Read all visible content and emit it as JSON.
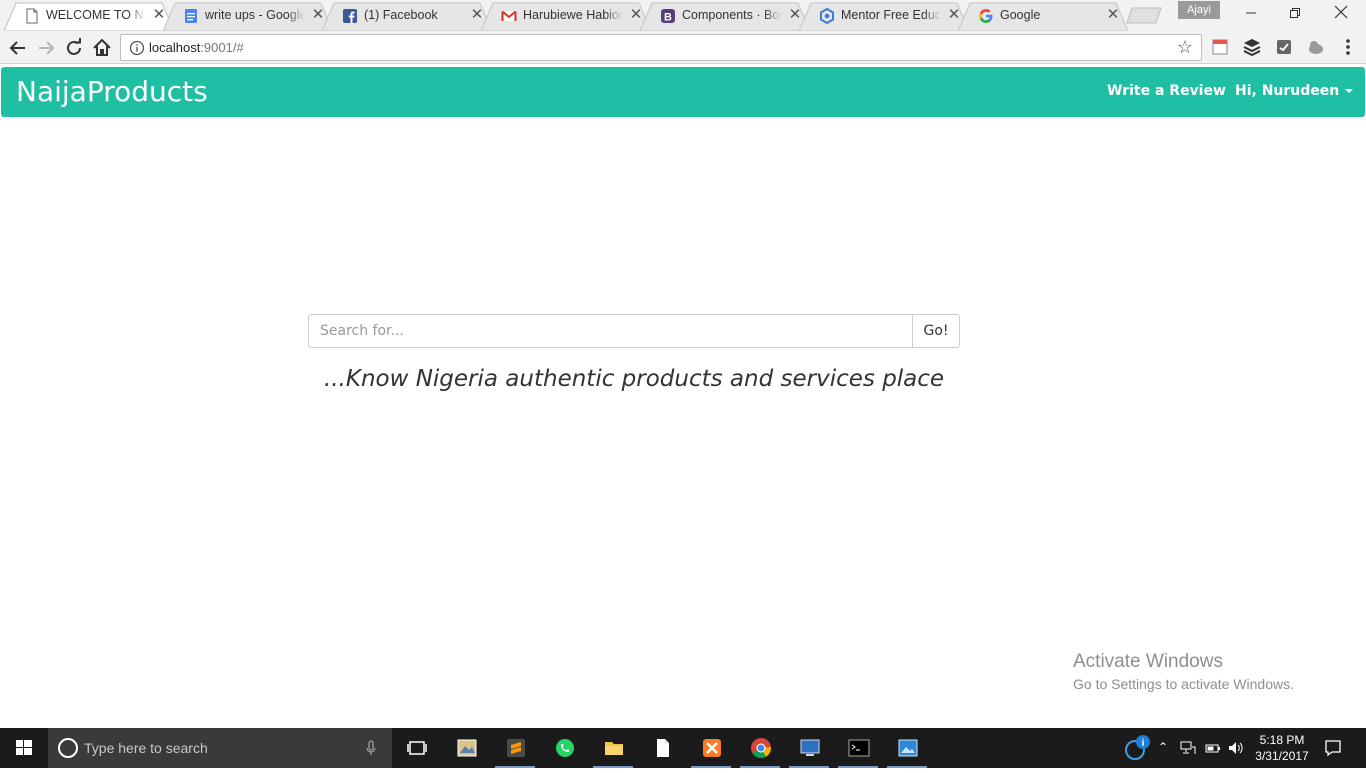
{
  "browser": {
    "tabs": [
      {
        "title": "WELCOME TO NAIJAPRODUCTS",
        "favicon": "page-icon",
        "active": true
      },
      {
        "title": "write ups - Google Docs",
        "favicon": "google-docs-icon",
        "active": false
      },
      {
        "title": "(1) Facebook",
        "favicon": "facebook-icon",
        "active": false
      },
      {
        "title": "Harubiewe Habiodun",
        "favicon": "gmail-icon",
        "active": false
      },
      {
        "title": "Components · Bootstrap",
        "favicon": "bootstrap-icon",
        "active": false
      },
      {
        "title": "Mentor Free Education",
        "favicon": "mentor-icon",
        "active": false
      },
      {
        "title": "Google",
        "favicon": "google-icon",
        "active": false
      }
    ],
    "profile_name": "Ajayi",
    "url_host": "localhost",
    "url_rest": ":9001/#"
  },
  "app": {
    "brand": "NaijaProducts",
    "nav": {
      "write_review": "Write a Review",
      "user_greeting": "Hi, Nurudeen"
    },
    "search": {
      "placeholder": "Search for...",
      "button_label": "Go!"
    },
    "tagline": "...Know Nigeria authentic products and services place",
    "accent_color": "#1fbfa4"
  },
  "watermark": {
    "title": "Activate Windows",
    "subtitle": "Go to Settings to activate Windows."
  },
  "taskbar": {
    "search_placeholder": "Type here to search",
    "time": "5:18 PM",
    "date": "3/31/2017"
  }
}
